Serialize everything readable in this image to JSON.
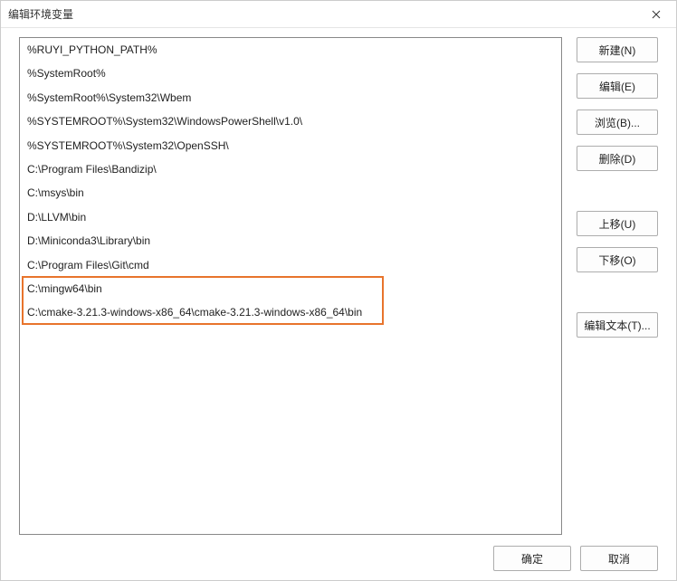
{
  "title": "编辑环境变量",
  "entries": [
    "%RUYI_PYTHON_PATH%",
    "%SystemRoot%",
    "%SystemRoot%\\System32\\Wbem",
    "%SYSTEMROOT%\\System32\\WindowsPowerShell\\v1.0\\",
    "%SYSTEMROOT%\\System32\\OpenSSH\\",
    "C:\\Program Files\\Bandizip\\",
    "C:\\msys\\bin",
    "D:\\LLVM\\bin",
    "D:\\Miniconda3\\Library\\bin",
    "C:\\Program Files\\Git\\cmd",
    "C:\\mingw64\\bin",
    "C:\\cmake-3.21.3-windows-x86_64\\cmake-3.21.3-windows-x86_64\\bin"
  ],
  "highlight": {
    "start_index": 10,
    "end_index": 11
  },
  "buttons": {
    "new": "新建(N)",
    "edit": "编辑(E)",
    "browse": "浏览(B)...",
    "delete": "删除(D)",
    "move_up": "上移(U)",
    "move_down": "下移(O)",
    "edit_text": "编辑文本(T)...",
    "ok": "确定",
    "cancel": "取消"
  }
}
